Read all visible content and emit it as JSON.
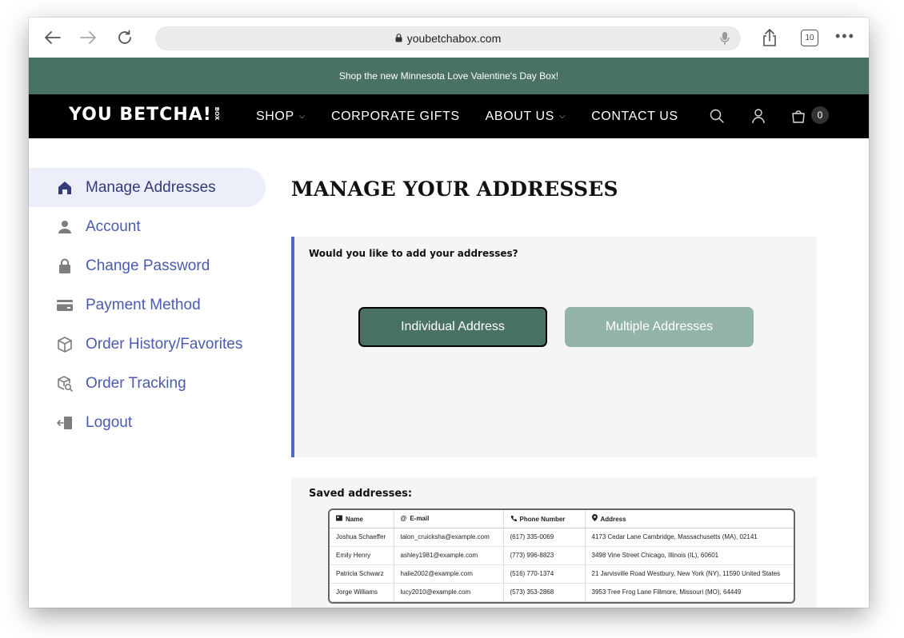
{
  "browser": {
    "url": "youbetchabox.com",
    "tab_count": "10"
  },
  "announcement": "Shop the new Minnesota Love Valentine's Day Box!",
  "nav": {
    "logo": "YOU BETCHA!",
    "logo_box": "BOX",
    "links": [
      {
        "label": "SHOP",
        "has_dropdown": true
      },
      {
        "label": "CORPORATE GIFTS",
        "has_dropdown": false
      },
      {
        "label": "ABOUT US",
        "has_dropdown": true
      },
      {
        "label": "CONTACT US",
        "has_dropdown": false
      }
    ],
    "cart_count": "0"
  },
  "sidebar": {
    "items": [
      {
        "label": "Manage Addresses",
        "icon": "home-icon",
        "active": true
      },
      {
        "label": "Account",
        "icon": "user-icon",
        "active": false
      },
      {
        "label": "Change Password",
        "icon": "lock-icon",
        "active": false
      },
      {
        "label": "Payment Method",
        "icon": "credit-card-icon",
        "active": false
      },
      {
        "label": "Order History/Favorites",
        "icon": "box-icon",
        "active": false
      },
      {
        "label": "Order Tracking",
        "icon": "box-search-icon",
        "active": false
      },
      {
        "label": "Logout",
        "icon": "logout-icon",
        "active": false
      }
    ]
  },
  "main": {
    "title": "MANAGE YOUR ADDRESSES",
    "question": "Would you like to add your addresses?",
    "buttons": {
      "individual": "Individual Address",
      "multiple": "Multiple Addresses"
    },
    "saved_title": "Saved addresses:",
    "table": {
      "headers": [
        "Name",
        "E-mail",
        "Phone Number",
        "Address"
      ],
      "rows": [
        [
          "Joshua Schaeffer",
          "talon_cruicksha@example.com",
          "(617) 335-0069",
          "4173 Cedar Lane Cambridge, Massachusetts (MA), 02141"
        ],
        [
          "Emily Henry",
          "ashley1981@example.com",
          "(773) 996-8823",
          "3498 Vine Street Chicago, Illinois (IL), 60601"
        ],
        [
          "Patricia Schwarz",
          "halie2002@example.com",
          "(516) 770-1374",
          "21 Jarvisville Road Westbury, New York (NY), 11590 United States"
        ],
        [
          "Jorge Williams",
          "lucy2010@example.com",
          "(573) 353-2868",
          "3953 Tree Frog Lane Fillmore, Missouri (MO), 64449"
        ]
      ]
    }
  },
  "colors": {
    "brand_green": "#4a7264",
    "light_green": "#93b4aa",
    "accent_blue": "#5068c9",
    "sidebar_text": "#4a5bb0"
  }
}
